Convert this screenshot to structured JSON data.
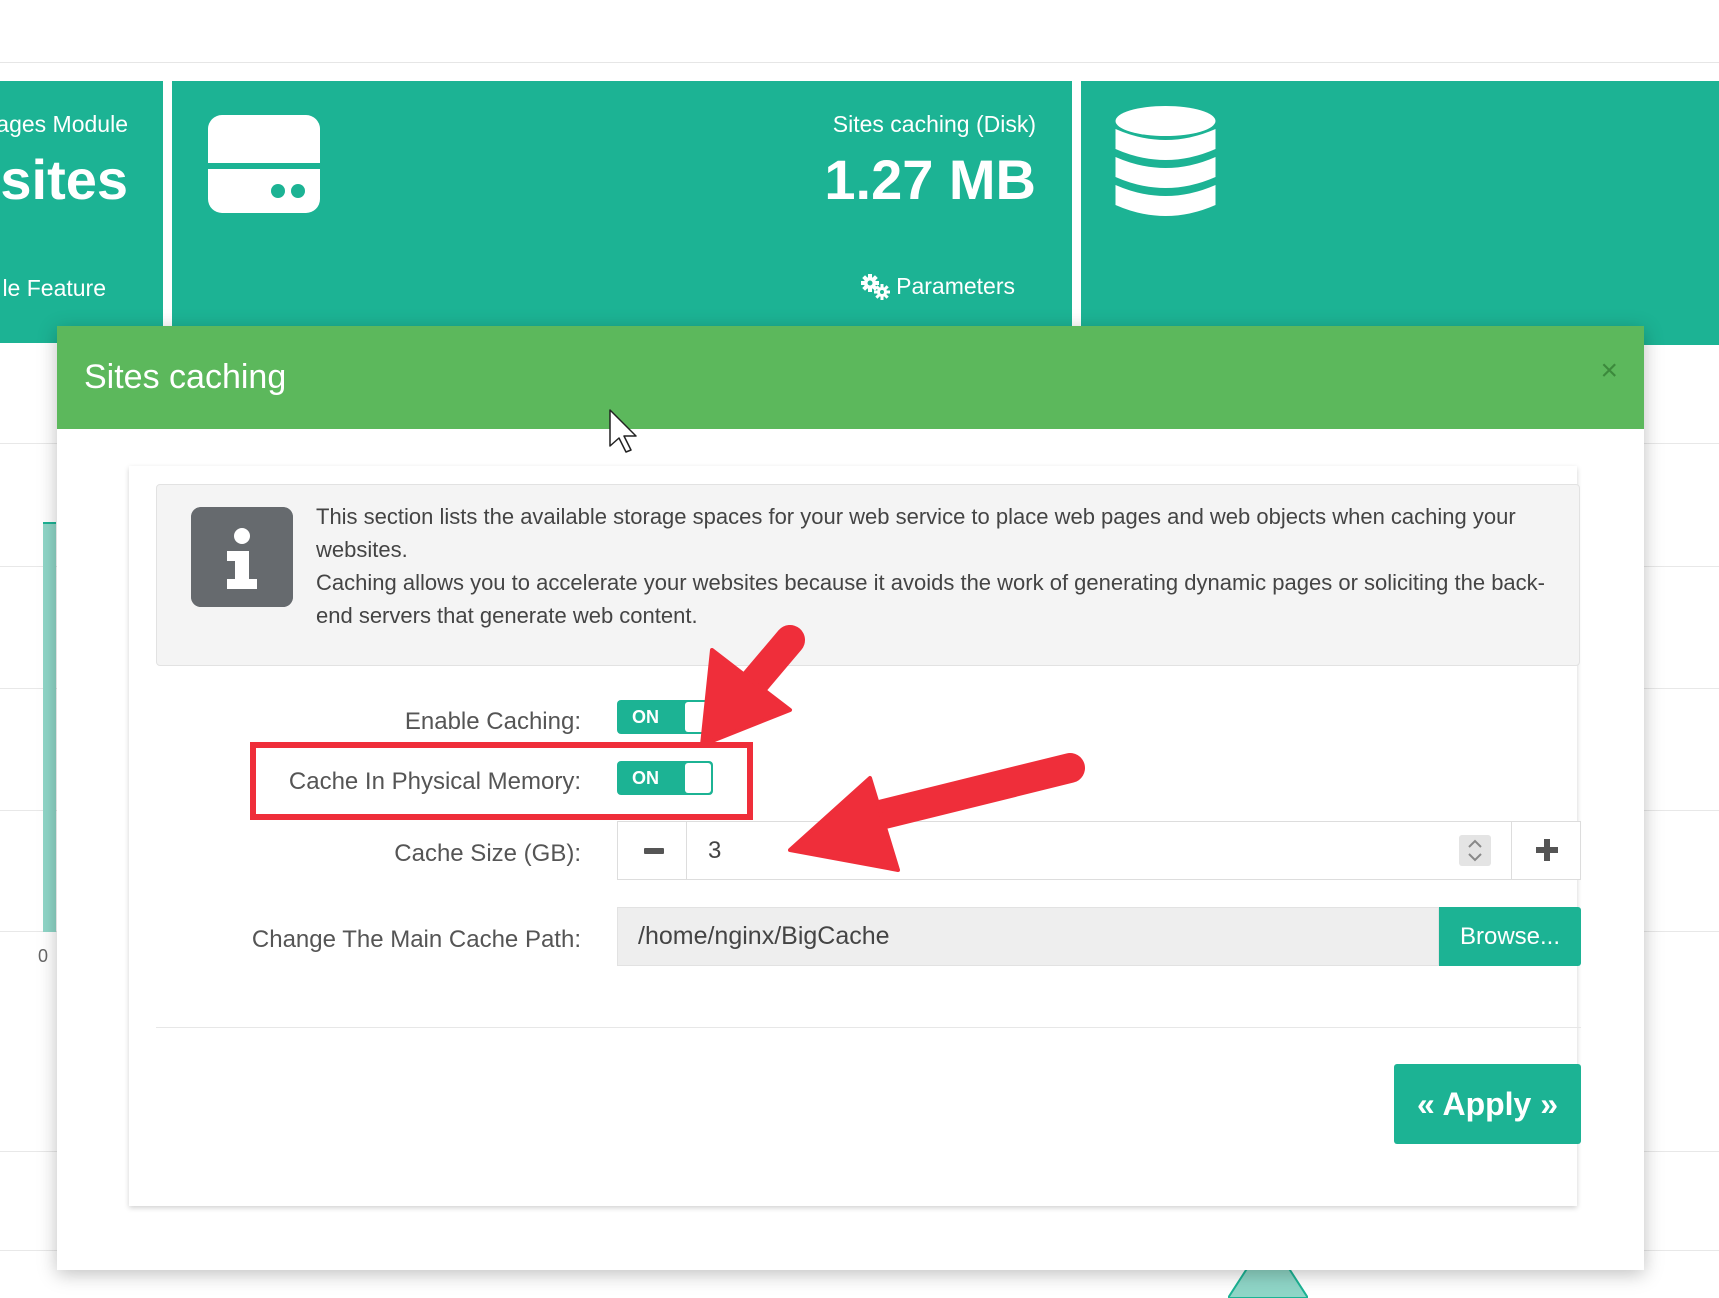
{
  "tiles": {
    "pages_module": {
      "caption": "ages Module",
      "value": "o sites",
      "link": "le Feature"
    },
    "disk_cache": {
      "icon": "hdd-icon",
      "caption": "Sites caching (Disk)",
      "value": "1.27 MB",
      "link_icon": "cogs-icon",
      "link": "Parameters"
    },
    "database": {
      "icon": "database-icon"
    }
  },
  "background_chart": {
    "axis_label": "0"
  },
  "modal": {
    "title": "Sites caching",
    "close_symbol": "×",
    "info": {
      "icon": "info-icon",
      "paragraph1": "This section lists the available storage spaces for your web service to place web pages and web objects when caching your websites.",
      "paragraph2": "Caching allows you to accelerate your websites because it avoids the work of generating dynamic pages or soliciting the back-end servers that generate web content."
    },
    "form": {
      "enable_caching": {
        "label": "Enable Caching:",
        "state": "ON"
      },
      "cache_in_memory": {
        "label": "Cache In Physical Memory:",
        "state": "ON"
      },
      "cache_size": {
        "label": "Cache Size (GB):",
        "value": "3"
      },
      "cache_path": {
        "label": "Change The Main Cache Path:",
        "value": "/home/nginx/BigCache",
        "browse_label": "Browse..."
      }
    },
    "apply_label": "« Apply »"
  },
  "colors": {
    "teal": "#1cb394",
    "modal_header_green": "#5cb85c",
    "annotation_red": "#ef2e3a"
  }
}
